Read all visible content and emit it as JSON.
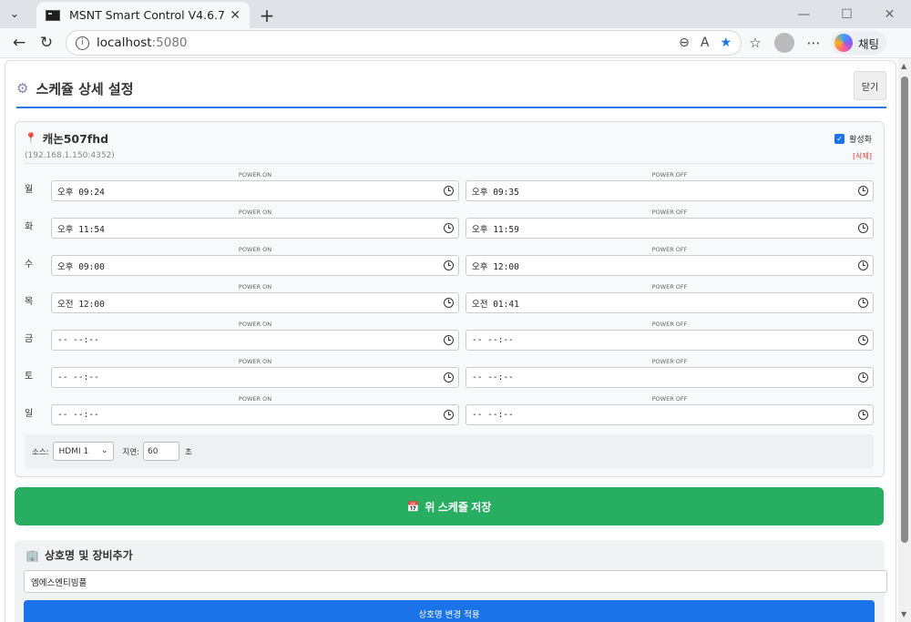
{
  "browser": {
    "tab_title": "MSNT Smart Control V4.6.7",
    "url_host": "localhost",
    "url_port": ":5080",
    "copilot_label": "채팅"
  },
  "modal": {
    "title": "스케쥴 상세 설정",
    "close_label": "닫기"
  },
  "device": {
    "name": "캐논507fhd",
    "address": "(192.168.1.150:4352)",
    "enable_label": "활성화",
    "delete_label": "[삭제]",
    "on_label": "POWER ON",
    "off_label": "POWER OFF",
    "schedule": [
      {
        "day": "월",
        "on": "오후 09:24",
        "off": "오후 09:35"
      },
      {
        "day": "화",
        "on": "오후 11:54",
        "off": "오후 11:59"
      },
      {
        "day": "수",
        "on": "오후 09:00",
        "off": "오후 12:00"
      },
      {
        "day": "목",
        "on": "오전 12:00",
        "off": "오전 01:41"
      },
      {
        "day": "금",
        "on": "-- --:--",
        "off": "-- --:--"
      },
      {
        "day": "토",
        "on": "-- --:--",
        "off": "-- --:--"
      },
      {
        "day": "일",
        "on": "-- --:--",
        "off": "-- --:--"
      }
    ],
    "source_label": "소스:",
    "source_value": "HDMI 1",
    "delay_label": "지연:",
    "delay_value": "60",
    "delay_unit": "초"
  },
  "save_label": "위 스케쥴 저장",
  "business": {
    "title": "상호명 및 장비추가",
    "name_value": "엠에스엔티빔플",
    "apply_label": "상호명 변경 적용"
  }
}
